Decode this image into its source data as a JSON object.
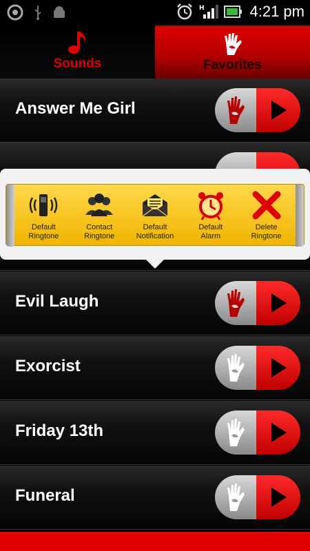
{
  "status_bar": {
    "time": "4:21 pm"
  },
  "tabs": [
    {
      "label": "Sounds",
      "icon": "music-note-icon",
      "selected": false
    },
    {
      "label": "Favorites",
      "icon": "bloody-hand-icon",
      "selected": true
    }
  ],
  "rows": [
    {
      "title": "Answer Me Girl"
    },
    {
      "title": "Evil Laugh"
    },
    {
      "title": "Exorcist"
    },
    {
      "title": "Friday 13th"
    },
    {
      "title": "Funeral"
    }
  ],
  "popup": {
    "actions": [
      {
        "label": "Default\nRingtone",
        "icon": "phone-ringing-icon"
      },
      {
        "label": "Contact\nRingtone",
        "icon": "contacts-icon"
      },
      {
        "label": "Default\nNotification",
        "icon": "envelope-icon"
      },
      {
        "label": "Default\nAlarm",
        "icon": "alarm-clock-icon"
      },
      {
        "label": "Delete\nRingtone",
        "icon": "delete-x-icon"
      }
    ]
  },
  "colors": {
    "accent": "#e00000",
    "popup_yellow": "#ffd84a"
  }
}
